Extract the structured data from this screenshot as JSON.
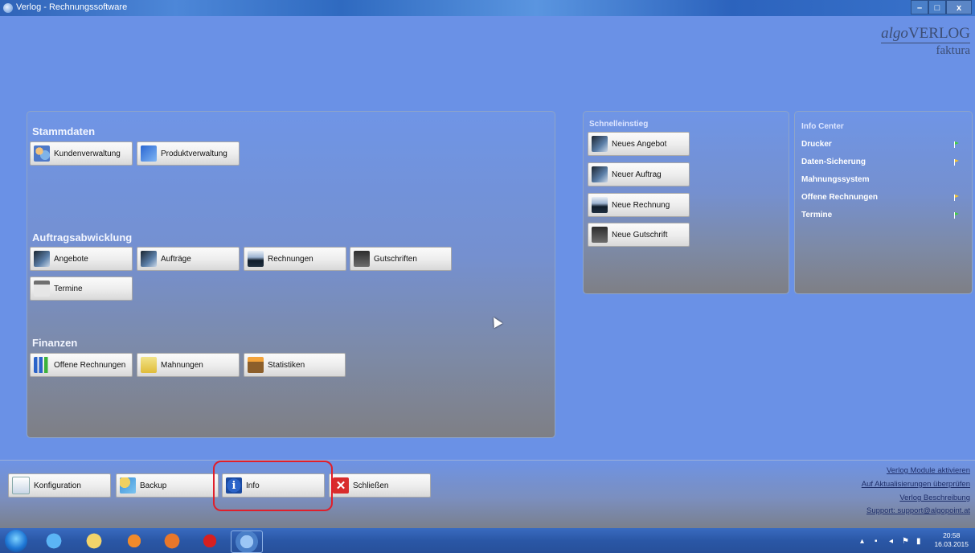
{
  "window": {
    "title": "Verlog - Rechnungssoftware",
    "controls": {
      "minimize": "–",
      "maximize": "□",
      "close": "x"
    }
  },
  "logo": {
    "brand_italic": "algo",
    "brand_rest": "VERLOG",
    "sub": "faktura"
  },
  "panels": {
    "stammdaten": {
      "title": "Stammdaten",
      "buttons": [
        "Kundenverwaltung",
        "Produktverwaltung"
      ]
    },
    "auftragsabwicklung": {
      "title": "Auftragsabwicklung",
      "buttons": [
        "Angebote",
        "Aufträge",
        "Rechnungen",
        "Gutschriften",
        "Termine"
      ]
    },
    "finanzen": {
      "title": "Finanzen",
      "buttons": [
        "Offene Rechnungen",
        "Mahnungen",
        "Statistiken"
      ]
    },
    "schnelleinstieg": {
      "title": "Schnelleinstieg",
      "buttons": [
        "Neues Angebot",
        "Neuer Auftrag",
        "Neue Rechnung",
        "Neue Gutschrift"
      ]
    },
    "infocenter": {
      "title": "Info Center",
      "rows": [
        {
          "label": "Drucker",
          "status_color": "#3fd03f"
        },
        {
          "label": "Daten-Sicherung",
          "status_color": "#f2c230"
        },
        {
          "label": "Mahnungssystem",
          "status_color": ""
        },
        {
          "label": "Offene Rechnungen",
          "status_color": "#f2c230"
        },
        {
          "label": "Termine",
          "status_color": "#3fd03f"
        }
      ]
    }
  },
  "bottom": {
    "buttons": [
      "Konfiguration",
      "Backup",
      "Info",
      "Schließen"
    ],
    "links": [
      "Verlog Module aktivieren",
      "Auf Aktualisierungen überprüfen",
      "Verlog Beschreibung",
      "Support: support@algopoint.at"
    ]
  },
  "taskbar": {
    "time": "20:58",
    "date": "16.03.2015"
  },
  "colors": {
    "highlight": "#e01f2a",
    "accent": "#6a91e6"
  }
}
